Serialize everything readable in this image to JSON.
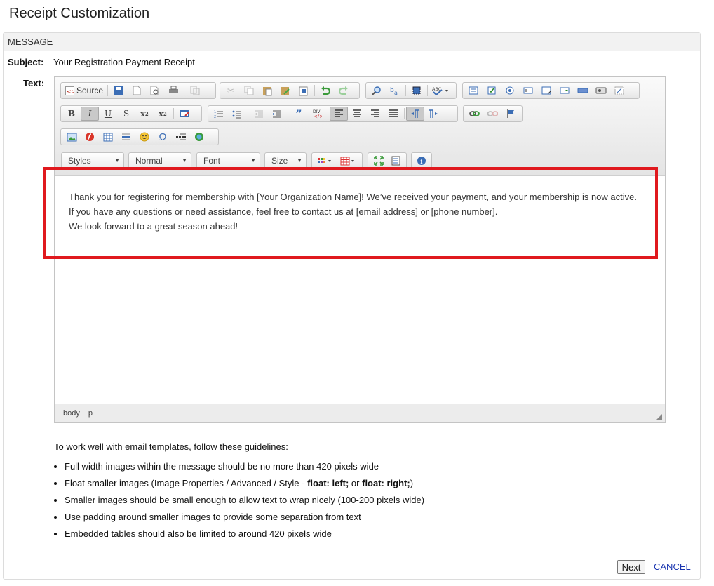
{
  "page": {
    "title": "Receipt Customization"
  },
  "panel": {
    "header": "MESSAGE",
    "subject_label": "Subject:",
    "subject_value": "Your Registration Payment Receipt",
    "text_label": "Text:"
  },
  "toolbar": {
    "source_label": "Source",
    "combos": {
      "styles": "Styles",
      "format": "Normal",
      "font": "Font",
      "size": "Size"
    }
  },
  "editor": {
    "lines": [
      "Thank you for registering for membership with [Your Organization Name]! We’ve received your payment, and your membership is now active.",
      "If you have any questions or need assistance, feel free to contact us at [email address] or [phone number].",
      "We look forward to a great season ahead!"
    ],
    "path": [
      "body",
      "p"
    ]
  },
  "guidelines": {
    "intro": "To work well with email templates, follow these guidelines:",
    "items": {
      "i1": "Full width images within the message should be no more than 420 pixels wide",
      "i2_a": "Float smaller images (Image Properties / Advanced / Style - ",
      "i2_b": "float: left;",
      "i2_c": " or ",
      "i2_d": "float: right;",
      "i2_e": ")",
      "i3": "Smaller images should be small enough to allow text to wrap nicely (100-200 pixels wide)",
      "i4": "Use padding around smaller images to provide some separation from text",
      "i5": "Embedded tables should also be limited to around 420 pixels wide"
    }
  },
  "actions": {
    "next": "Next",
    "cancel": "CANCEL"
  },
  "colors": {
    "highlight": "#e0191e",
    "link": "#1a35b0"
  }
}
